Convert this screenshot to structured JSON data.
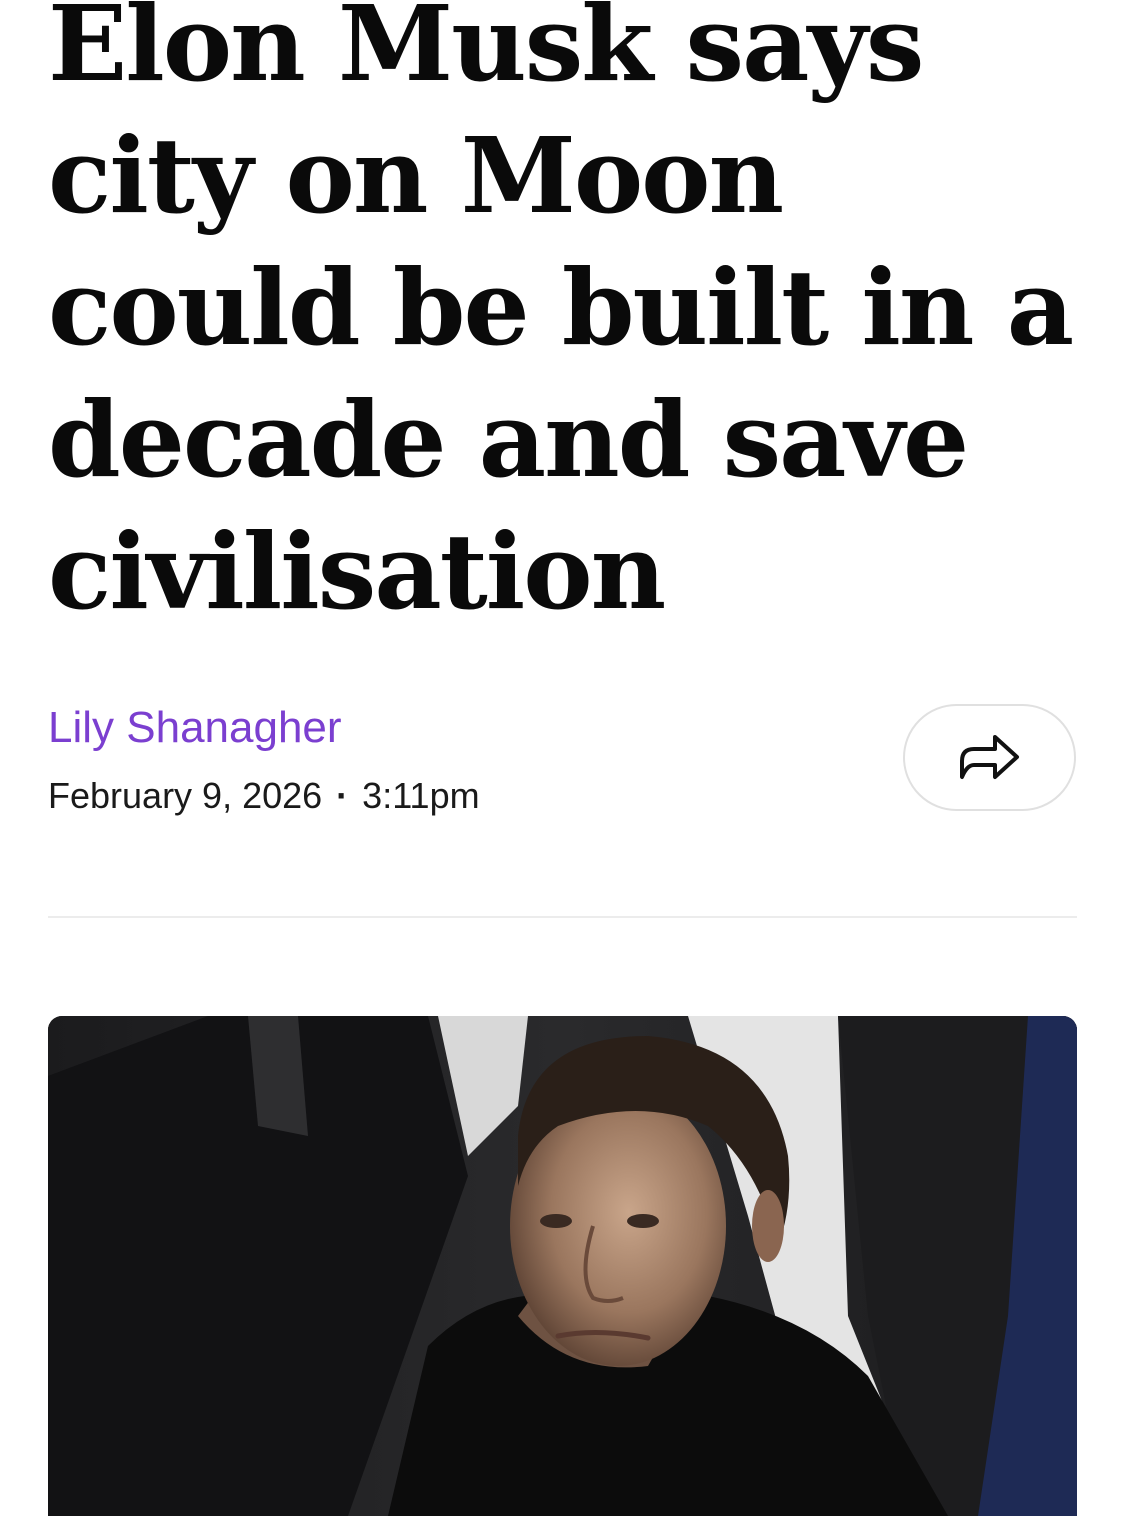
{
  "article": {
    "headline": "Elon Musk says city on Moon could be built in a decade and save civilisation",
    "author": "Lily Shanagher",
    "date": "February 9, 2026",
    "separator": "·",
    "time": "3:11pm"
  },
  "share": {
    "icon": "share-arrow-icon"
  },
  "hero_image": {
    "subject": "man-in-black-hoodie-photo"
  },
  "colors": {
    "author_link": "#7b3fd0",
    "headline": "#0a0a0a",
    "divider": "#ececec"
  }
}
